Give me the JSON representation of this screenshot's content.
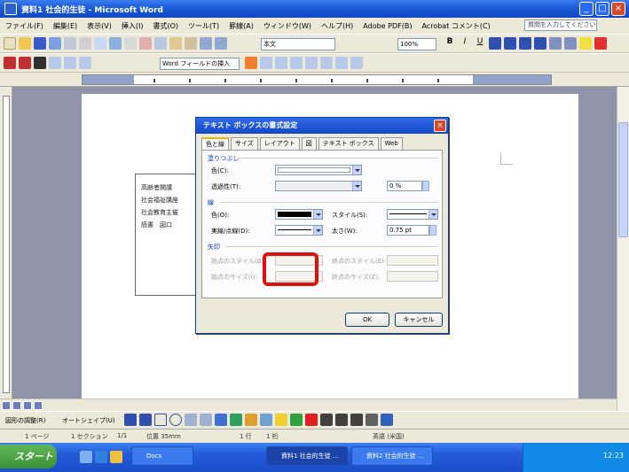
{
  "window": {
    "title": "資料1 社会的生徒 - Microsoft Word",
    "controls": [
      "_",
      "□",
      "×"
    ]
  },
  "menu": [
    "ファイル(F)",
    "編集(E)",
    "表示(V)",
    "挿入(I)",
    "書式(O)",
    "ツール(T)",
    "罫線(A)",
    "ウィンドウ(W)",
    "ヘルプ(H)",
    "Adobe PDF(B)",
    "Acrobat コメント(C)"
  ],
  "help_box": "質問を入力してください",
  "toolbar": {
    "style_combo": "本文",
    "zoom_combo": "100%",
    "insert_field": "Word フィールドの挿入"
  },
  "textbox_lines": [
    "高齢者開講",
    "社会福祉講座",
    "社会教育主催",
    "読書　図口"
  ],
  "draw_bar": {
    "draw_label": "図形の調整(R)",
    "autoshape_label": "オートシェイプ(U)"
  },
  "status": {
    "page": "1 ページ",
    "section": "1 セクション",
    "position": "1/1",
    "location": "位置 35mm",
    "line": "1 行",
    "column": "1 桁",
    "language": "英語 (米国)"
  },
  "taskbar": {
    "start_label": "スタート",
    "tasks": [
      "Docs",
      "資料1 社会的生徒 ...",
      "資料2 社会的生徒 ..."
    ],
    "clock": "12:23"
  },
  "dialog": {
    "title": "テキスト ボックスの書式設定",
    "tabs": [
      "色と線",
      "サイズ",
      "レイアウト",
      "図",
      "テキスト ボックス",
      "Web"
    ],
    "groups": {
      "fill": "塗りつぶし",
      "line": "線",
      "arrow": "矢印"
    },
    "fields": {
      "fill_color": "色(C):",
      "transparency": "透過性(T):",
      "transparency_value": "0 %",
      "line_color": "色(O):",
      "line_style": "スタイル(S):",
      "dash": "実線/点線(D):",
      "weight": "太さ(W):",
      "weight_value": "0.75 pt",
      "begin_style": "始点のスタイル(B):",
      "end_style": "終点のスタイル(E):",
      "begin_size": "始点のサイズ(I):",
      "end_size": "終点のサイズ(Z):"
    },
    "ok": "OK",
    "cancel": "キャンセル"
  },
  "colors": {
    "titlebar": "#1a5bd8",
    "highlight": "#e01010",
    "dialog_face": "#ece9d8"
  }
}
